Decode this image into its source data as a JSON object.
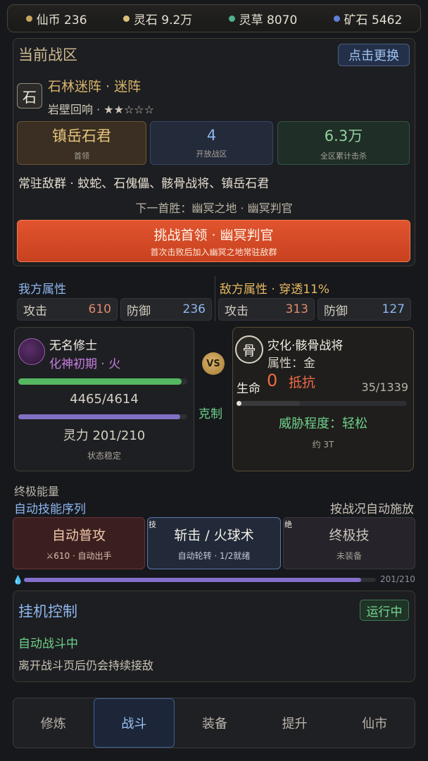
{
  "resources": [
    {
      "icon": "coin-icon",
      "label": "仙币 236",
      "color": "#c9a45b"
    },
    {
      "icon": "spirit-stone-icon",
      "label": "灵石 9.2万",
      "color": "#d8c07a"
    },
    {
      "icon": "herb-icon",
      "label": "灵草 8070",
      "color": "#4fb38a"
    },
    {
      "icon": "ore-icon",
      "label": "矿石 5462",
      "color": "#5f7fd6"
    }
  ],
  "zone": {
    "title": "当前战区",
    "switch_label": "点击更换",
    "icon_char": "石",
    "stage_name": "石林迷阵 · 迷阵",
    "stage_sub": "岩壁回响 · ★★☆☆☆",
    "stats": [
      {
        "value": "镇岳石君",
        "label": "首领"
      },
      {
        "value": "4",
        "label": "开放战区"
      },
      {
        "value": "6.3万",
        "label": "全区累计击杀"
      }
    ],
    "enemies": "常驻敌群 · 蚊蛇、石傀儡、骸骨战将、镇岳石君",
    "next_boss": "下一首胜：幽冥之地 · 幽冥判官",
    "challenge_title": "挑战首领 · 幽冥判官",
    "challenge_sub": "首次击败后加入幽冥之地常驻敌群"
  },
  "attributes": {
    "mine_title": "我方属性",
    "enemy_title": "敌方属性 · 穿透11%",
    "mine": [
      {
        "label": "攻击",
        "value": "610",
        "color": "#e08a6a"
      },
      {
        "label": "防御",
        "value": "236",
        "color": "#8fb6ef"
      }
    ],
    "enemy": [
      {
        "label": "攻击",
        "value": "313",
        "color": "#e08a6a"
      },
      {
        "label": "防御",
        "value": "127",
        "color": "#8fb6ef"
      }
    ]
  },
  "player": {
    "name": "无名修士",
    "realm": "化神初期 · 火",
    "hp_text": "4465/4614",
    "hp_fraction": 0.9677,
    "mp_text": "灵力 201/210",
    "mp_fraction": 0.957,
    "status": "状态稳定"
  },
  "vs_label": "VS",
  "counter_label": "克制",
  "enemy": {
    "icon_char": "骨",
    "name": "灾化·骸骨战将",
    "attr": "属性：金",
    "life_label": "生命",
    "life_value": "0",
    "resist_label": "抵抗",
    "hp_text": "35/1339",
    "hp_fraction": 0.026,
    "threat": "威胁程度：轻松",
    "turns": "约 3T"
  },
  "skills": {
    "energy_title": "终极能量",
    "sequence_title": "自动技能序列",
    "auto_cast": "按战况自动施放",
    "items": [
      {
        "name": "自动普攻",
        "desc": "⚔610 · 自动出手",
        "tag": ""
      },
      {
        "name": "斩击 / 火球术",
        "desc": "自动轮转 · 1/2就绪",
        "tag": "技"
      },
      {
        "name": "终极技",
        "desc": "未装备",
        "tag": "绝"
      }
    ],
    "energy_text": "201/210",
    "energy_fraction": 0.957
  },
  "idle": {
    "title": "挂机控制",
    "status_button": "运行中",
    "state": "自动战斗中",
    "desc": "离开战斗页后仍会持续接敌"
  },
  "nav": [
    "修炼",
    "战斗",
    "装备",
    "提升",
    "仙市"
  ],
  "nav_active": 1
}
